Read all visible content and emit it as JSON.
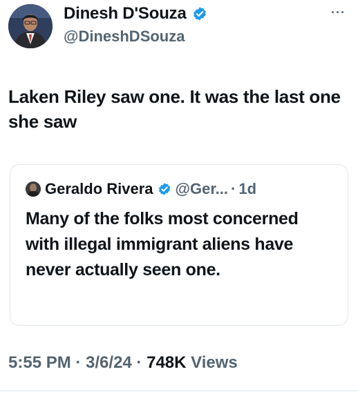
{
  "author": {
    "display_name": "Dinesh D'Souza",
    "handle": "@DineshDSouza",
    "verified_icon": "verified-badge-icon",
    "avatar_icon": "profile-photo"
  },
  "more_label": "···",
  "tweet": {
    "text": "Laken Riley saw one. It was the last one she saw"
  },
  "quoted_tweet": {
    "display_name": "Geraldo Rivera",
    "handle": "@Ger...",
    "separator": "·",
    "time": "1d",
    "text": "Many of the folks most concerned with illegal immigrant aliens have never actually seen one."
  },
  "meta": {
    "time": "5:55 PM",
    "sep1": " · ",
    "date": "3/6/24",
    "sep2": " · ",
    "views_count": "748K",
    "views_label": " Views"
  },
  "colors": {
    "text": "#0f1419",
    "secondary": "#536471",
    "verified": "#1d9bf0",
    "border": "#e1e6ea"
  }
}
